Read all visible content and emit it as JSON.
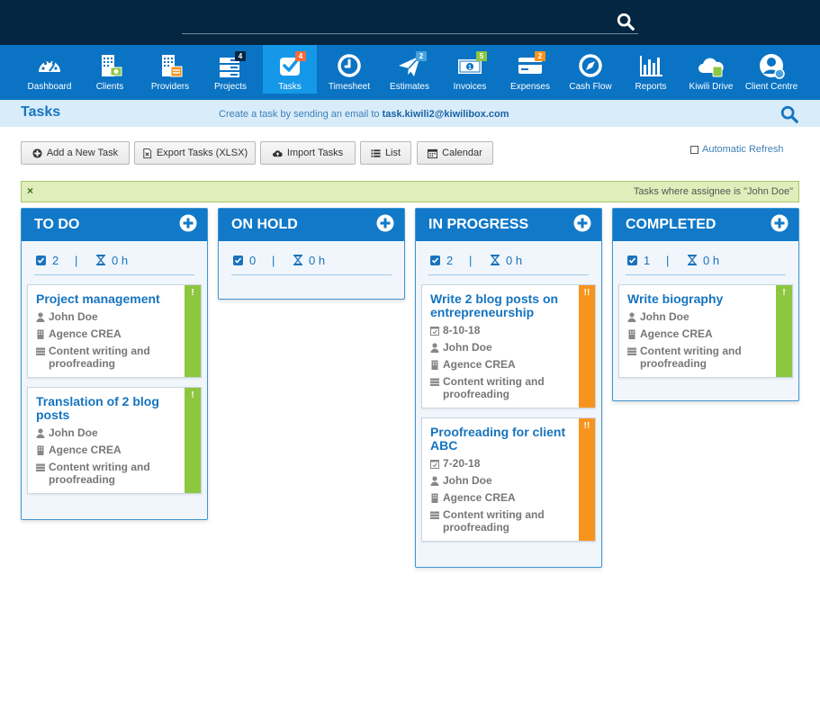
{
  "search": {
    "placeholder": ""
  },
  "nav": {
    "items": [
      {
        "label": "Dashboard",
        "icon": "dashboard-icon"
      },
      {
        "label": "Clients",
        "icon": "clients-icon"
      },
      {
        "label": "Providers",
        "icon": "providers-icon"
      },
      {
        "label": "Projects",
        "icon": "projects-icon",
        "badge": "4"
      },
      {
        "label": "Tasks",
        "icon": "tasks-icon",
        "badge": "4",
        "active": true
      },
      {
        "label": "Timesheet",
        "icon": "timesheet-icon"
      },
      {
        "label": "Estimates",
        "icon": "estimates-icon",
        "badge": "2"
      },
      {
        "label": "Invoices",
        "icon": "invoices-icon",
        "badge": "5"
      },
      {
        "label": "Expenses",
        "icon": "expenses-icon",
        "badge": "2"
      },
      {
        "label": "Cash Flow",
        "icon": "cash-flow-icon"
      },
      {
        "label": "Reports",
        "icon": "reports-icon"
      },
      {
        "label": "Kiwili Drive",
        "icon": "cloud-drive-icon"
      },
      {
        "label": "Client Centre",
        "icon": "client-centre-icon"
      }
    ]
  },
  "header": {
    "title": "Tasks",
    "email_hint_prefix": "Create a task by sending an email to ",
    "email": "task.kiwili2@kiwilibox.com"
  },
  "toolbar": {
    "add_task": "Add a New Task",
    "export": "Export Tasks (XLSX)",
    "import": "Import Tasks",
    "list": "List",
    "calendar": "Calendar",
    "auto_refresh": "Automatic Refresh"
  },
  "filter": {
    "close": "×",
    "text": "Tasks where assignee is \"John Doe\""
  },
  "colors": {
    "green_priority": "#8dc63f",
    "orange_priority": "#f7941d",
    "accent": "#1179c8"
  },
  "columns": [
    {
      "title": "TO DO",
      "count": "2",
      "hours": "0 h",
      "cards": [
        {
          "title": "Project management",
          "date": "",
          "assignee": "John Doe",
          "client": "Agence CREA",
          "project": "Content writing and proofreading",
          "flag": "!",
          "priority": "green"
        },
        {
          "title": "Translation of 2 blog posts",
          "date": "",
          "assignee": "John Doe",
          "client": "Agence CREA",
          "project": "Content writing and proofreading",
          "flag": "!",
          "priority": "green"
        }
      ]
    },
    {
      "title": "ON HOLD",
      "count": "0",
      "hours": "0 h",
      "cards": []
    },
    {
      "title": "IN PROGRESS",
      "count": "2",
      "hours": "0 h",
      "cards": [
        {
          "title": "Write 2 blog posts on entrepreneurship",
          "date": "8-10-18",
          "assignee": "John Doe",
          "client": "Agence CREA",
          "project": "Content writing and proofreading",
          "flag": "!!",
          "priority": "orange"
        },
        {
          "title": "Proofreading for client ABC",
          "date": "7-20-18",
          "assignee": "John Doe",
          "client": "Agence CREA",
          "project": "Content writing and proofreading",
          "flag": "!!",
          "priority": "orange"
        }
      ]
    },
    {
      "title": "COMPLETED",
      "count": "1",
      "hours": "0 h",
      "cards": [
        {
          "title": "Write biography",
          "date": "",
          "assignee": "John Doe",
          "client": "Agence CREA",
          "project": "Content writing and proofreading",
          "flag": "!",
          "priority": "green"
        }
      ]
    }
  ]
}
